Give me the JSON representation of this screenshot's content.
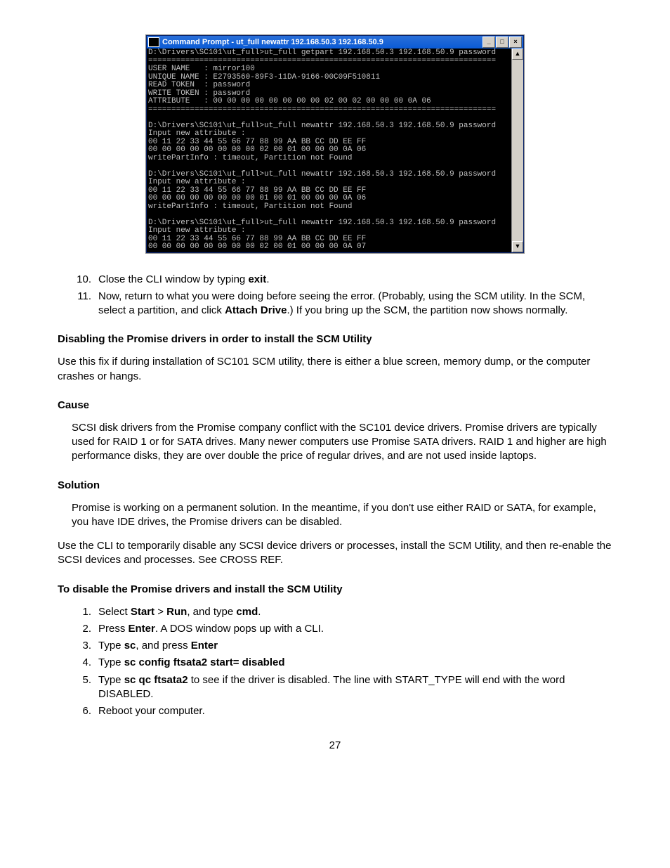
{
  "cmd": {
    "title": "Command Prompt - ut_full newattr 192.168.50.3 192.168.50.9",
    "icon_name": "cmd-icon",
    "content": "D:\\Drivers\\SC101\\ut_full>ut_full getpart 192.168.50.3 192.168.50.9 password\n===========================================================================\nUSER NAME   : mirror100\nUNIQUE NAME : E2793560-89F3-11DA-9166-00C09F510811\nREAD TOKEN  : password\nWRITE TOKEN : password\nATTRIBUTE   : 00 00 00 00 00 00 00 00 02 00 02 00 00 00 0A 06\n===========================================================================\n\nD:\\Drivers\\SC101\\ut_full>ut_full newattr 192.168.50.3 192.168.50.9 password\nInput new attribute :\n00 11 22 33 44 55 66 77 88 99 AA BB CC DD EE FF\n00 00 00 00 00 00 00 00 02 00 01 00 00 00 0A 06\nwritePartInfo : timeout, Partition not Found\n\nD:\\Drivers\\SC101\\ut_full>ut_full newattr 192.168.50.3 192.168.50.9 password\nInput new attribute :\n00 11 22 33 44 55 66 77 88 99 AA BB CC DD EE FF\n00 00 00 00 00 00 00 00 01 00 01 00 00 00 0A 06\nwritePartInfo : timeout, Partition not Found\n\nD:\\Drivers\\SC101\\ut_full>ut_full newattr 192.168.50.3 192.168.50.9 password\nInput new attribute :\n00 11 22 33 44 55 66 77 88 99 AA BB CC DD EE FF\n00 00 00 00 00 00 00 00 02 00 01 00 00 00 0A 07"
  },
  "steps_a": {
    "s10_pre": "Close the CLI window by typing ",
    "s10_bold": "exit",
    "s10_post": ".",
    "s11_pre": "Now, return to what you were doing before seeing the error. (Probably, using the SCM utility. In the SCM, select a partition, and click ",
    "s11_bold": "Attach Drive",
    "s11_post": ".) If you bring up the SCM, the partition now shows normally."
  },
  "h1": "Disabling the Promise drivers in order to install the SCM Utility",
  "p1": "Use this fix if during installation of SC101 SCM utility, there is either a blue screen, memory dump, or the computer crashes or hangs.",
  "h_cause": "Cause",
  "p_cause": "SCSI disk drivers from the Promise company conflict with the SC101 device drivers. Promise drivers are typically used for RAID 1 or for SATA drives. Many newer computers use Promise SATA drivers. RAID 1 and higher are high performance disks, they are over double the price of regular drives, and are not used inside laptops.",
  "h_solution": "Solution",
  "p_solution": "Promise is working on a permanent solution. In the meantime, if you don't use either RAID or SATA, for example, you have IDE drives, the Promise drivers can be disabled.",
  "p2": "Use the CLI to temporarily disable any SCSI device drivers or processes, install the SCM Utility, and then re-enable the SCSI devices and processes. See CROSS REF.",
  "h2": "To disable the Promise drivers and install the SCM Utility",
  "steps_b": {
    "s1": {
      "t1": "Select ",
      "b1": "Start",
      "t2": " > ",
      "b2": "Run",
      "t3": ", and type ",
      "b3": "cmd",
      "t4": "."
    },
    "s2": {
      "t1": "Press ",
      "b1": "Enter",
      "t2": ". A DOS window pops up with a CLI."
    },
    "s3": {
      "t1": "Type ",
      "b1": "sc",
      "t2": ", and press ",
      "b2": "Enter"
    },
    "s4": {
      "t1": "Type ",
      "b1": "sc config ftsata2 start= disabled"
    },
    "s5": {
      "t1": "Type ",
      "b1": "sc qc ftsata2",
      "t2": " to see if the driver is disabled. The line with START_TYPE will end with the word DISABLED."
    },
    "s6": {
      "t1": "Reboot your computer."
    }
  },
  "page_number": "27"
}
